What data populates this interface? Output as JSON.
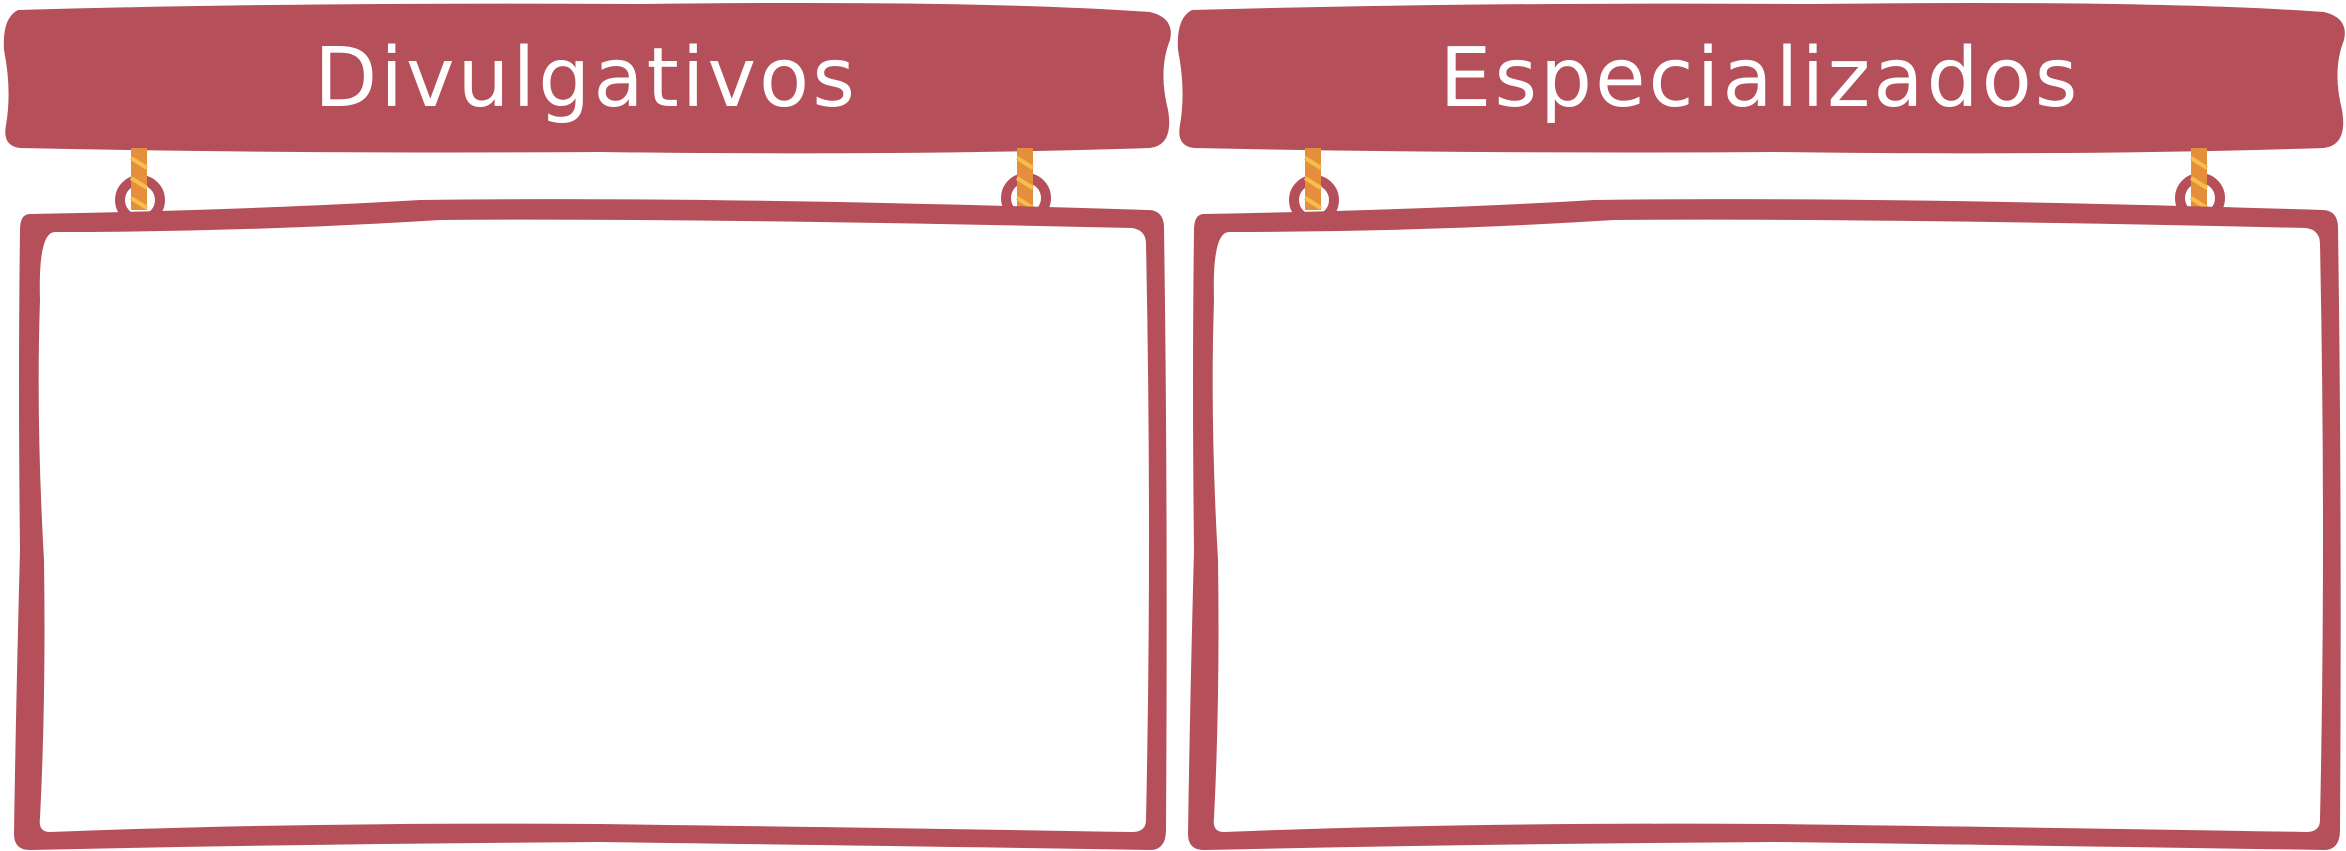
{
  "colors": {
    "board": "#b5505a",
    "rope": "#e58e3b",
    "rope_stripe": "#f4c04a",
    "panel": "#ffffff",
    "text": "#ffffff"
  },
  "signs": [
    {
      "title": "Divulgativos",
      "body": ""
    },
    {
      "title": "Especializados",
      "body": ""
    }
  ]
}
